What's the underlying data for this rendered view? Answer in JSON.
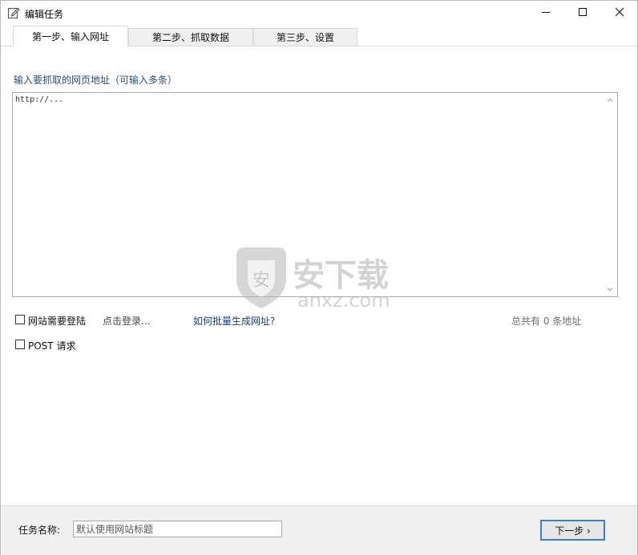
{
  "window": {
    "title": "编辑任务"
  },
  "tabs": [
    {
      "label": "第一步、输入网址",
      "active": true
    },
    {
      "label": "第二步、抓取数据",
      "active": false
    },
    {
      "label": "第三步、设置",
      "active": false
    }
  ],
  "urls": {
    "label": "输入要抓取的网页地址（可输入多条）",
    "value": "http://..."
  },
  "options": {
    "login_label": "网站需要登陆",
    "login_checked": false,
    "login_link": "点击登录...",
    "howto_link": "如何批量生成网址?",
    "count_text": "总共有 0 条地址",
    "post_label": "POST 请求",
    "post_checked": false
  },
  "watermark": {
    "text_cn": "安下载",
    "text_en": "anxz.com"
  },
  "footer": {
    "task_name_label": "任务名称:",
    "task_name_placeholder": "默认使用网站标题",
    "next_button": "下一步 ›"
  },
  "colors": {
    "accent_border": "#3c7ddb",
    "label_blue": "#2d4f77",
    "link_blue": "#173b8c"
  }
}
